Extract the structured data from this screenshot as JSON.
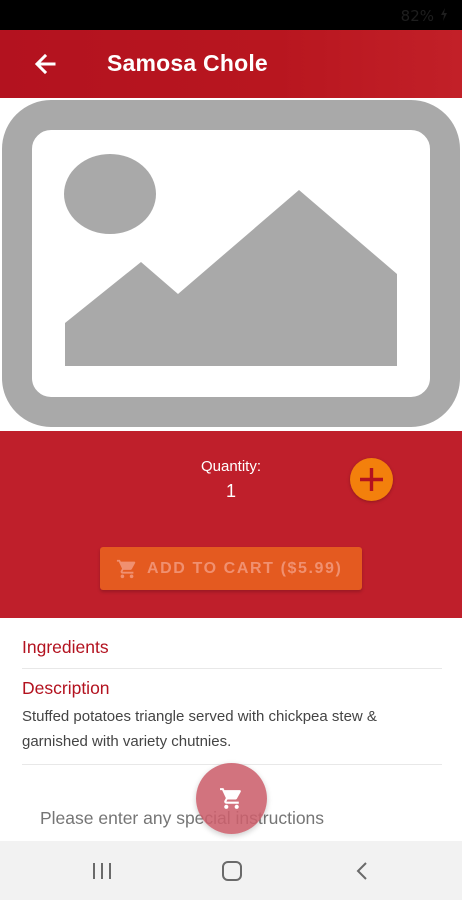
{
  "status_bar": {
    "battery": "82%"
  },
  "app_bar": {
    "title": "Samosa Chole"
  },
  "quantity": {
    "label": "Quantity:",
    "value": "1"
  },
  "cart_button": {
    "label": "ADD TO CART ($5.99)"
  },
  "ingredients": {
    "heading": "Ingredients"
  },
  "description": {
    "heading": "Description",
    "text": "Stuffed potatoes triangle served with chickpea stew & garnished with variety chutnies."
  },
  "instructions": {
    "placeholder": "Please enter any special instructions"
  },
  "icons": {
    "back": "arrow-left-icon",
    "image_placeholder": "image-placeholder-icon",
    "plus": "plus-icon",
    "cart": "shopping-cart-icon",
    "nav_recents": "recents-icon",
    "nav_home": "home-icon",
    "nav_back": "chevron-left-icon"
  },
  "colors": {
    "primary": "#b3121f",
    "panel": "#bf1f2b",
    "accent": "#f3800c",
    "cart_button": "#e45a20"
  }
}
